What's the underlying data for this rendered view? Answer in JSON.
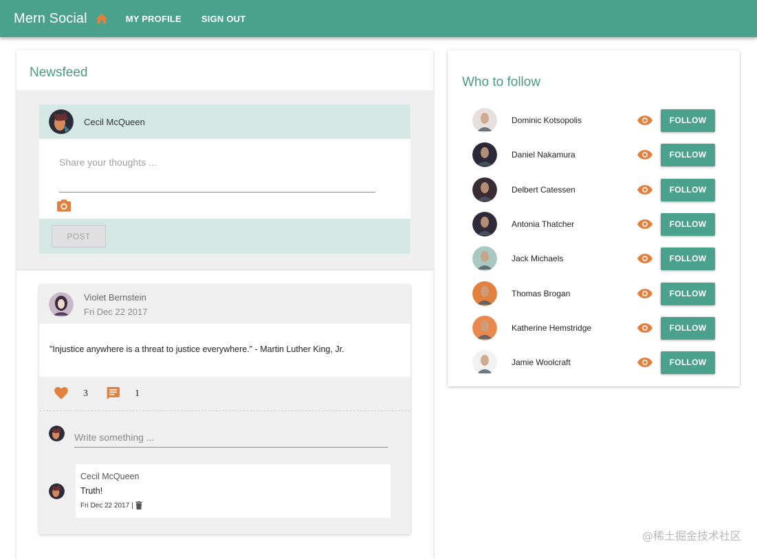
{
  "app": {
    "brand": "Mern Social",
    "nav": {
      "home_icon": "home-icon",
      "profile": "MY PROFILE",
      "signout": "SIGN OUT"
    },
    "colors": {
      "primary": "#4aa28c",
      "accent": "#e0813f",
      "tint": "#d5e8e4",
      "title_green": "#4b9b83"
    }
  },
  "newsfeed": {
    "title": "Newsfeed",
    "new_post": {
      "user_name": "Cecil McQueen",
      "placeholder": "Share your thoughts ...",
      "photo_icon": "camera-icon",
      "post_label": "POST"
    },
    "posts": [
      {
        "author": "Violet Bernstein",
        "date": "Fri Dec 22 2017",
        "text": "\"Injustice anywhere is a threat to justice everywhere.\" - Martin Luther King, Jr.",
        "likes": "3",
        "comments_count": "1",
        "comment_placeholder": "Write something ...",
        "comments": [
          {
            "author": "Cecil McQueen",
            "text": "Truth!",
            "date": "Fri Dec 22 2017",
            "separator": "|"
          }
        ]
      }
    ]
  },
  "follow": {
    "title": "Who to follow",
    "button_label": "FOLLOW",
    "people": [
      {
        "name": "Dominic Kotsopolis"
      },
      {
        "name": "Daniel Nakamura"
      },
      {
        "name": "Delbert Catessen"
      },
      {
        "name": "Antonia Thatcher"
      },
      {
        "name": "Jack Michaels"
      },
      {
        "name": "Thomas Brogan"
      },
      {
        "name": "Katherine Hemstridge"
      },
      {
        "name": "Jamie Woolcraft"
      }
    ]
  },
  "watermark": "@稀土掘金技术社区"
}
